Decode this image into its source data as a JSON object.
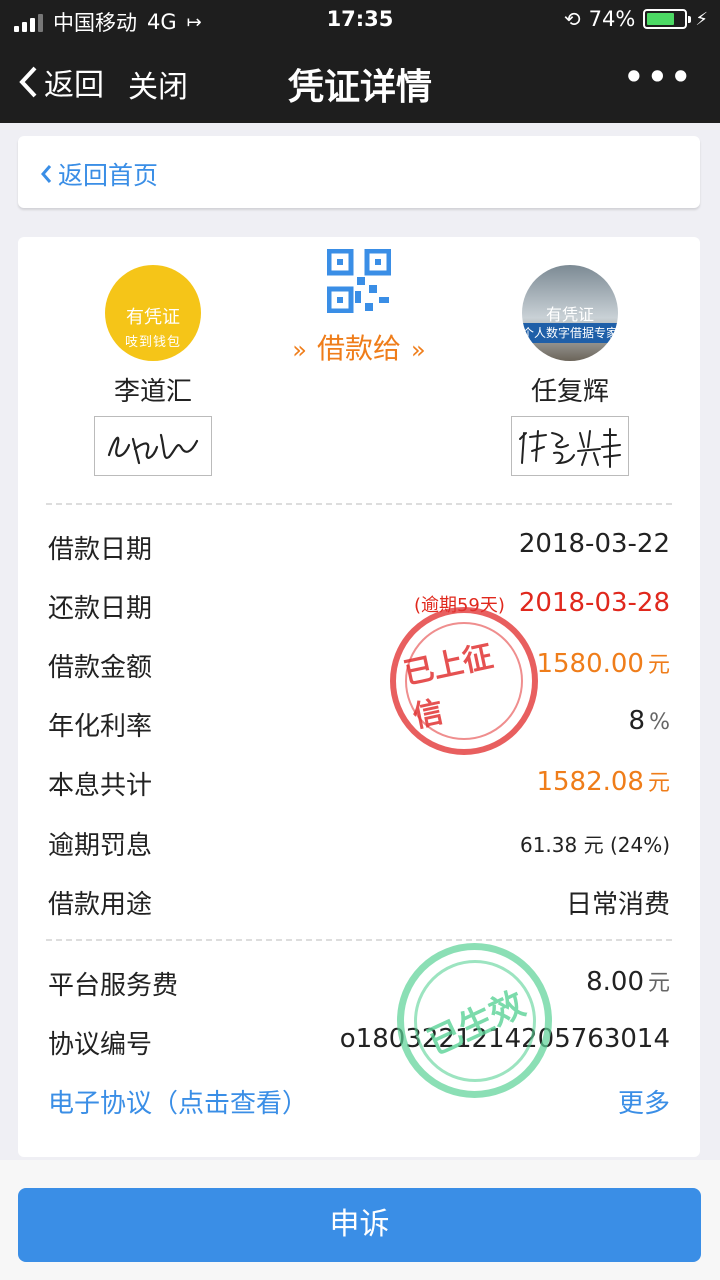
{
  "status_bar": {
    "carrier": "中国移动",
    "network": "4G",
    "time": "17:35",
    "battery": "74%",
    "battery_level": 0.74
  },
  "nav": {
    "back_label": "返回",
    "close_label": "关闭",
    "title": "凭证详情",
    "more_label": "•••"
  },
  "back_home_label": "返回首页",
  "lender": {
    "name": "李道汇",
    "avatar_text": "有凭证",
    "avatar_subtext": "吱到钱包"
  },
  "borrower": {
    "name": "任复辉",
    "avatar_text": "有凭证",
    "avatar_subtext": "个人数字借据专家"
  },
  "lend_to_label": "借款给",
  "details": {
    "loan_date": {
      "label": "借款日期",
      "value": "2018-03-22"
    },
    "repay_date": {
      "label": "还款日期",
      "overdue": "(逾期59天)",
      "value": "2018-03-28"
    },
    "amount": {
      "label": "借款金额",
      "value": "1580.00",
      "unit": "元"
    },
    "rate": {
      "label": "年化利率",
      "value": "8",
      "unit": "%"
    },
    "total": {
      "label": "本息共计",
      "value": "1582.08",
      "unit": "元"
    },
    "penalty": {
      "label": "逾期罚息",
      "value": "61.38 元 (24%)"
    },
    "purpose": {
      "label": "借款用途",
      "value": "日常消费"
    },
    "service_fee": {
      "label": "平台服务费",
      "value": "8.00",
      "unit": "元"
    },
    "agreement_no": {
      "label": "协议编号",
      "value": "o180322121420576301​4"
    }
  },
  "e_agreement_label": "电子协议（点击查看）",
  "more_label": "更多",
  "stamps": {
    "red": "已上征信",
    "green": "已生效"
  },
  "appeal_label": "申诉",
  "colors": {
    "accent": "#3a8ee6",
    "orange": "#ef7d1a",
    "red": "#e0281d"
  }
}
